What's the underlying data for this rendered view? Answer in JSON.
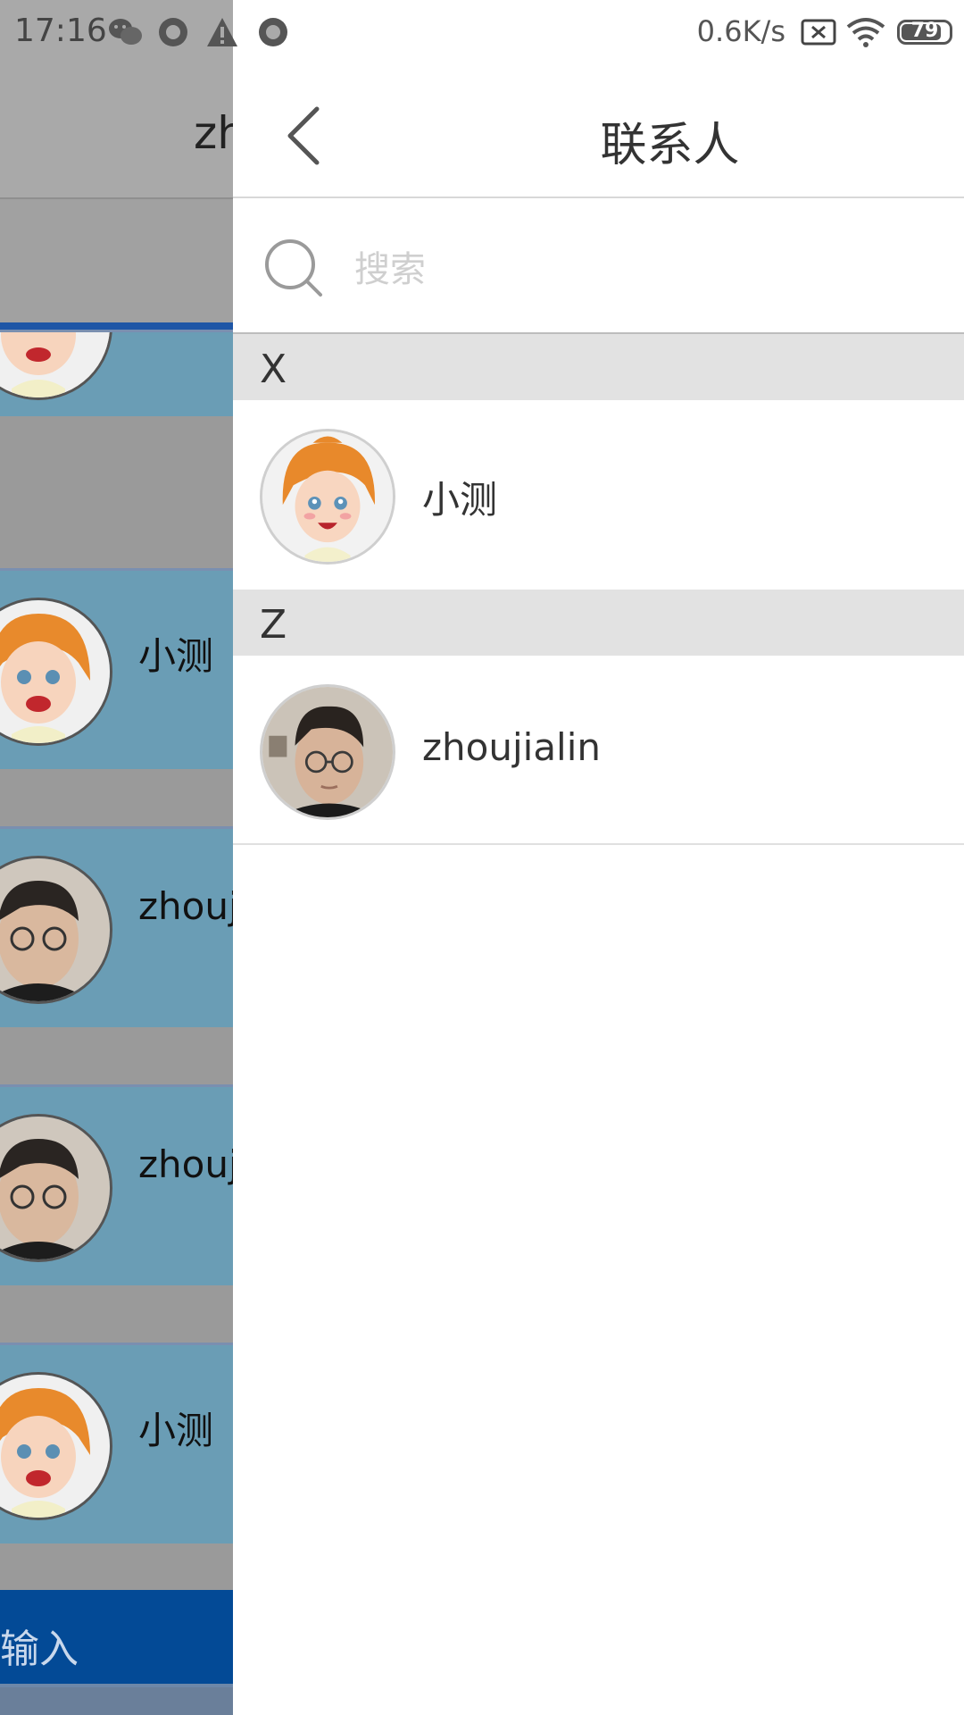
{
  "status_bar": {
    "time": "17:16",
    "net_speed": "0.6K/s",
    "battery": "79"
  },
  "background_app": {
    "header_text": "zh",
    "rows": [
      {
        "name": ""
      },
      {
        "name": "小测"
      },
      {
        "name": "zhouj"
      },
      {
        "name": "zhouj"
      },
      {
        "name": "小测"
      }
    ],
    "bottom_input": "输入"
  },
  "drawer": {
    "title": "联系人",
    "search": {
      "placeholder": "搜索"
    },
    "sections": [
      {
        "letter": "X",
        "contacts": [
          {
            "name": "小测"
          }
        ]
      },
      {
        "letter": "Z",
        "contacts": [
          {
            "name": "zhoujialin"
          }
        ]
      }
    ]
  },
  "colors": {
    "accent": "#034a96",
    "dim_overlay": "#a9a9a9",
    "row_blue": "#6a9db5",
    "section_bg": "#e2e2e2"
  }
}
